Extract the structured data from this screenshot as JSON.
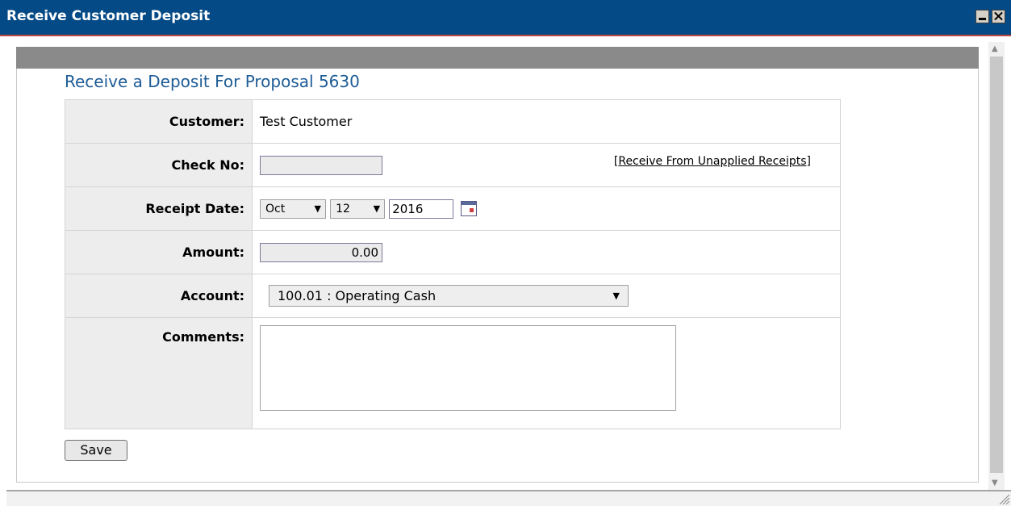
{
  "window": {
    "title": "Receive Customer Deposit"
  },
  "form": {
    "heading": "Receive a Deposit For Proposal 5630",
    "customer_label": "Customer:",
    "customer_value": "Test Customer",
    "check_label": "Check No:",
    "check_value": "",
    "unapplied_link": "Receive From Unapplied Receipts",
    "date_label": "Receipt Date:",
    "month": "Oct",
    "day": "12",
    "year": "2016",
    "amount_label": "Amount:",
    "amount_value": "0.00",
    "account_label": "Account:",
    "account_value": "100.01 : Operating Cash",
    "comments_label": "Comments:",
    "comments_value": ""
  },
  "actions": {
    "save": "Save"
  }
}
